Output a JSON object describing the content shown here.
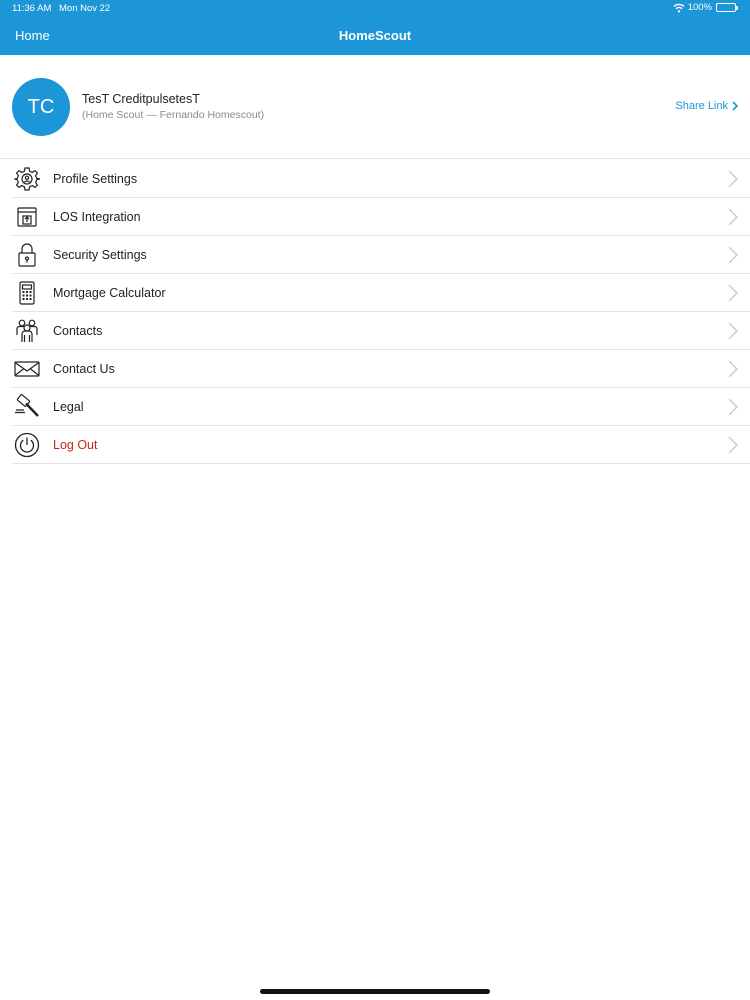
{
  "status_bar": {
    "time": "11:36 AM",
    "date": "Mon Nov 22",
    "battery": "100%"
  },
  "nav": {
    "back_label": "Home",
    "title": "HomeScout"
  },
  "profile": {
    "initials": "TC",
    "name": "TesT CreditpulsetesT",
    "subtitle": "(Home Scout — Fernando Homescout)",
    "share_label": "Share Link"
  },
  "menu": {
    "items": [
      {
        "label": "Profile Settings",
        "icon": "gear-icon"
      },
      {
        "label": "LOS Integration",
        "icon": "upload-icon"
      },
      {
        "label": "Security Settings",
        "icon": "lock-icon"
      },
      {
        "label": "Mortgage Calculator",
        "icon": "calculator-icon"
      },
      {
        "label": "Contacts",
        "icon": "people-icon"
      },
      {
        "label": "Contact Us",
        "icon": "envelope-icon"
      },
      {
        "label": "Legal",
        "icon": "gavel-icon"
      },
      {
        "label": "Log Out",
        "icon": "power-icon"
      }
    ]
  },
  "colors": {
    "primary": "#1c96d6",
    "danger": "#c8261c",
    "divider": "#e4e4e4",
    "chevron": "#c7c7cc"
  }
}
